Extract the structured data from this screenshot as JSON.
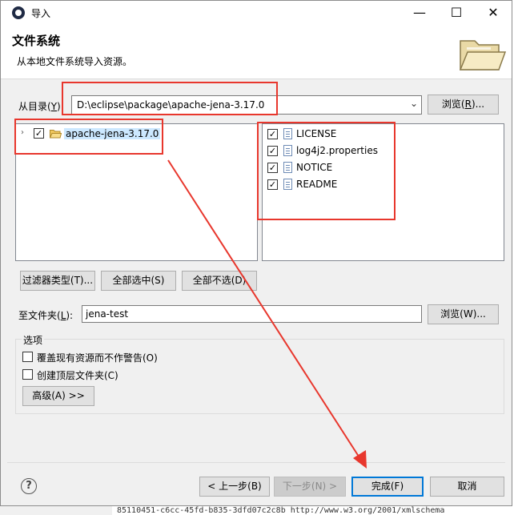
{
  "window": {
    "title": "导入",
    "minimize": "—",
    "maximize": "☐",
    "close": "✕"
  },
  "header": {
    "title": "文件系统",
    "description": "从本地文件系统导入资源。"
  },
  "source": {
    "label": "从目录(",
    "label_key": "Y",
    "label_end": "):",
    "value": "D:\\eclipse\\package\\apache-jena-3.17.0",
    "browse_label": "浏览(",
    "browse_key": "R",
    "browse_end": ")..."
  },
  "tree": {
    "expander": "›",
    "folder_label": "apache-jena-3.17.0",
    "checked": "✓"
  },
  "files": [
    {
      "name": "LICENSE"
    },
    {
      "name": "log4j2.properties"
    },
    {
      "name": "NOTICE"
    },
    {
      "name": "README"
    }
  ],
  "selection_buttons": {
    "filter": "过滤器类型(T)...",
    "select_all": "全部选中(S)",
    "deselect_all": "全部不选(D)"
  },
  "destination": {
    "label": "至文件夹(",
    "label_key": "L",
    "label_end": "):",
    "value": "jena-test",
    "browse_label": "浏览(W)..."
  },
  "options": {
    "group_label": "选项",
    "overwrite_label": "覆盖现有资源而不作警告(O)",
    "create_top_label": "创建顶层文件夹(C)",
    "advanced_label": "高级(A) >>"
  },
  "footer": {
    "help": "?",
    "back": "< 上一步(B)",
    "next": "下一步(N) >",
    "finish": "完成(F)",
    "cancel": "取消"
  },
  "background_text": "85110451-c6cc-45fd-b835-3dfd07c2c8b  http://www.w3.org/2001/xmlschema",
  "colors": {
    "highlight_red": "#e8372d",
    "selection_blue": "#cce8ff",
    "focus_blue": "#0078d7"
  }
}
